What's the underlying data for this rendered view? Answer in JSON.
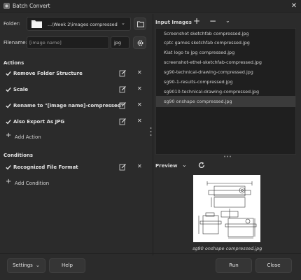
{
  "window": {
    "title": "Batch Convert",
    "icon": "gimp-app-icon"
  },
  "destination": {
    "folder_label": "Folder:",
    "folder_value": "...\\Week 2\\images compressed",
    "filename_label": "Filename:",
    "filename_value": "[image name]",
    "extension_value": "jpg"
  },
  "actions": {
    "title": "Actions",
    "items": [
      {
        "label": "Remove Folder Structure",
        "checked": true
      },
      {
        "label": "Scale",
        "checked": true
      },
      {
        "label": "Rename to \"[image name]-compressed\"",
        "checked": true
      },
      {
        "label": "Also Export As JPG",
        "checked": true
      }
    ],
    "add_label": "Add Action"
  },
  "conditions": {
    "title": "Conditions",
    "items": [
      {
        "label": "Recognized File Format",
        "checked": true
      }
    ],
    "add_label": "Add Condition"
  },
  "input_images": {
    "title": "Input Images",
    "files": [
      "Screenshot sketchfab compressed.jpg",
      "cptc games sketchfab compressed.jpg",
      "Kiat logo to jpg compressed.jpg",
      "screenshot-ethel-sketchfab-compressed.jpg",
      "sg90-technical-drawing-compressed.jpg",
      "sg90-1-results-compressed.jpg",
      "sg9010-technical-drawing-compressed.jpg",
      "sg90 onshape compressed.jpg"
    ],
    "selected_index": 7
  },
  "preview": {
    "title": "Preview",
    "caption": "sg90 onshape compressed.jpg"
  },
  "buttons": {
    "settings": "Settings",
    "help": "Help",
    "run": "Run",
    "close": "Close"
  },
  "colors": {
    "background": "#2b2b2b",
    "panel": "#1f1f1f",
    "selected": "#3b3b3b",
    "text": "#d6d6d6"
  }
}
